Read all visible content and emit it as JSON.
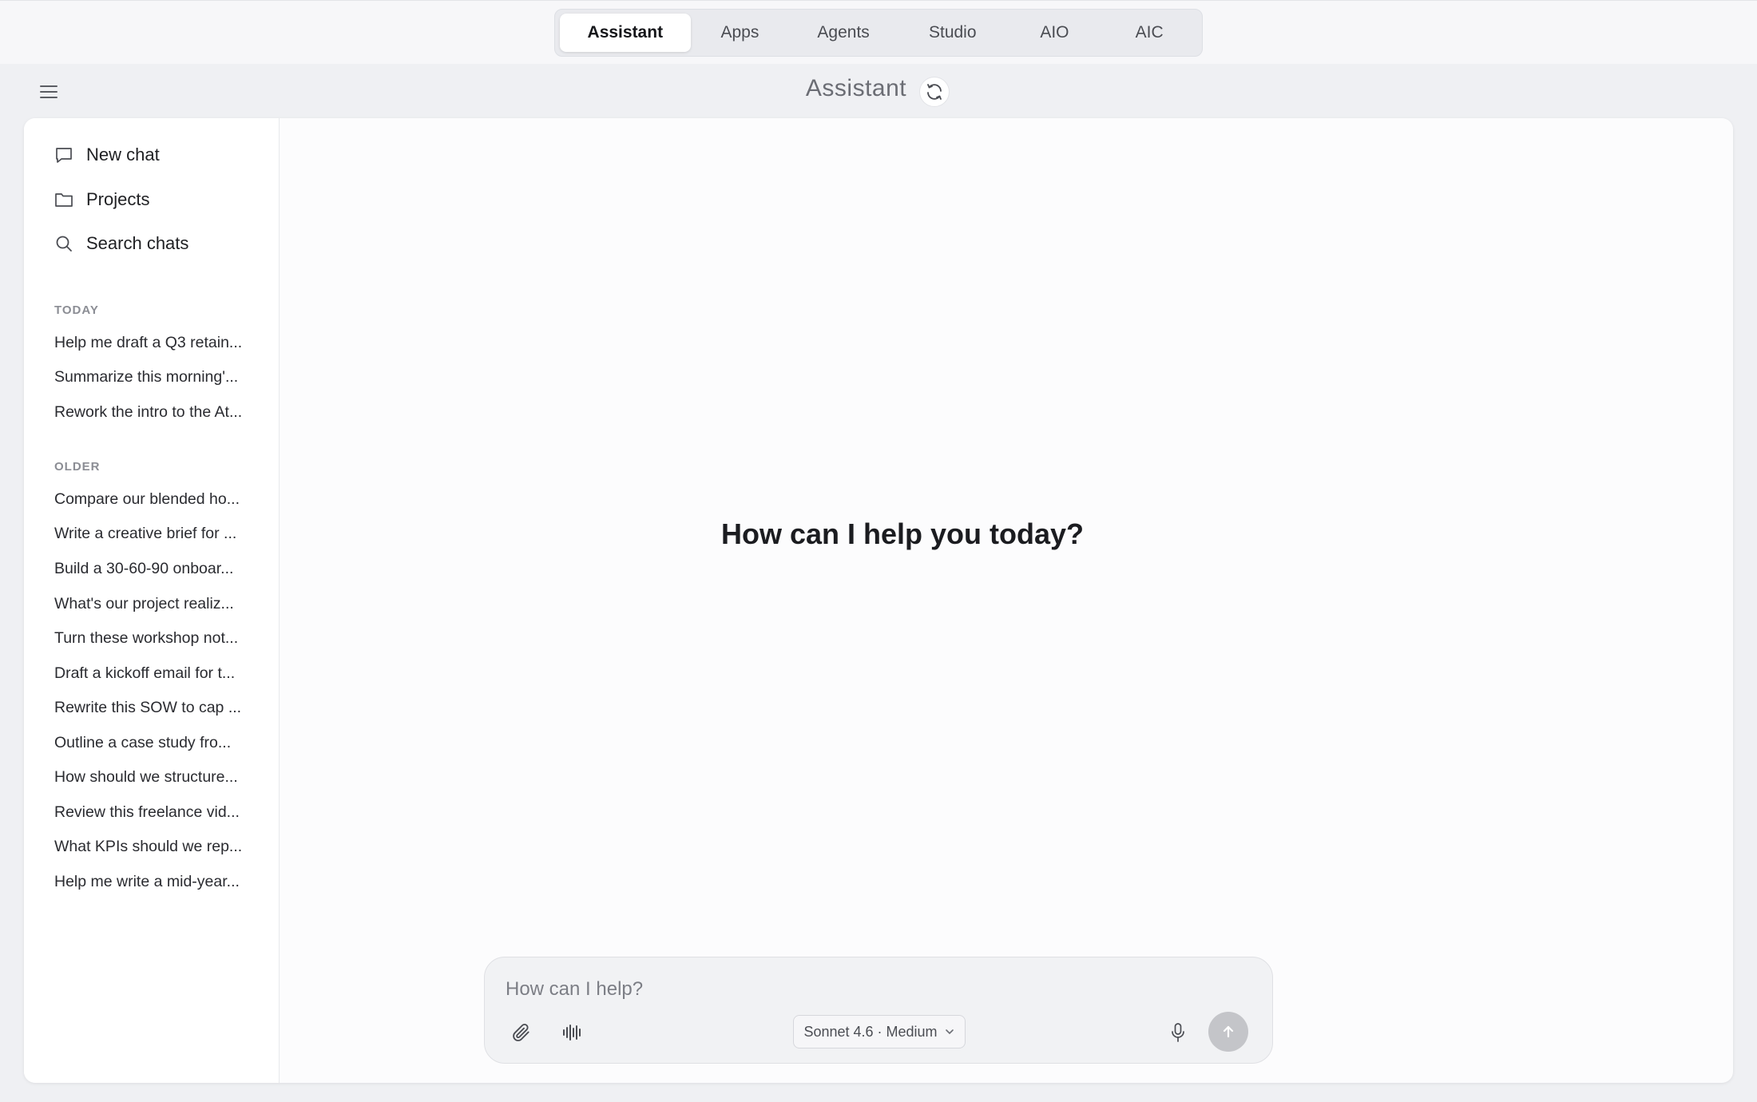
{
  "nav": {
    "tabs": [
      {
        "label": "Assistant",
        "active": true
      },
      {
        "label": "Apps",
        "active": false
      },
      {
        "label": "Agents",
        "active": false
      },
      {
        "label": "Studio",
        "active": false
      },
      {
        "label": "AIO",
        "active": false
      },
      {
        "label": "AIC",
        "active": false
      }
    ]
  },
  "header": {
    "title": "Assistant",
    "menu_icon": "hamburger-menu-icon",
    "refresh_icon": "refresh-icon"
  },
  "sidebar": {
    "actions": [
      {
        "label": "New chat",
        "icon": "chat-bubble-icon"
      },
      {
        "label": "Projects",
        "icon": "folder-icon"
      },
      {
        "label": "Search chats",
        "icon": "search-icon"
      }
    ],
    "today_label": "TODAY",
    "today": [
      "Help me draft a Q3 retain...",
      "Summarize this morning'...",
      "Rework the intro to the At..."
    ],
    "older_label": "OLDER",
    "older": [
      "Compare our blended ho...",
      "Write a creative brief for ...",
      "Build a 30-60-90 onboar...",
      "What's our project realiz...",
      "Turn these workshop not...",
      "Draft a kickoff email for t...",
      "Rewrite this SOW to cap ...",
      "Outline a case study fro...",
      "How should we structure...",
      "Review this freelance vid...",
      "What KPIs should we rep...",
      "Help me write a mid-year..."
    ]
  },
  "main": {
    "welcome": "How can I help you today?"
  },
  "composer": {
    "placeholder": "How can I help?",
    "value": "",
    "model_label": "Sonnet 4.6 · Medium",
    "icons": [
      "paperclip-icon",
      "waveform-icon",
      "microphone-icon",
      "send-arrow-icon",
      "chevron-down-icon"
    ]
  },
  "colors": {
    "page_bg": "#eff0f3",
    "panel_bg": "#fcfcfd",
    "send_disabled": "#c4c5c9"
  }
}
